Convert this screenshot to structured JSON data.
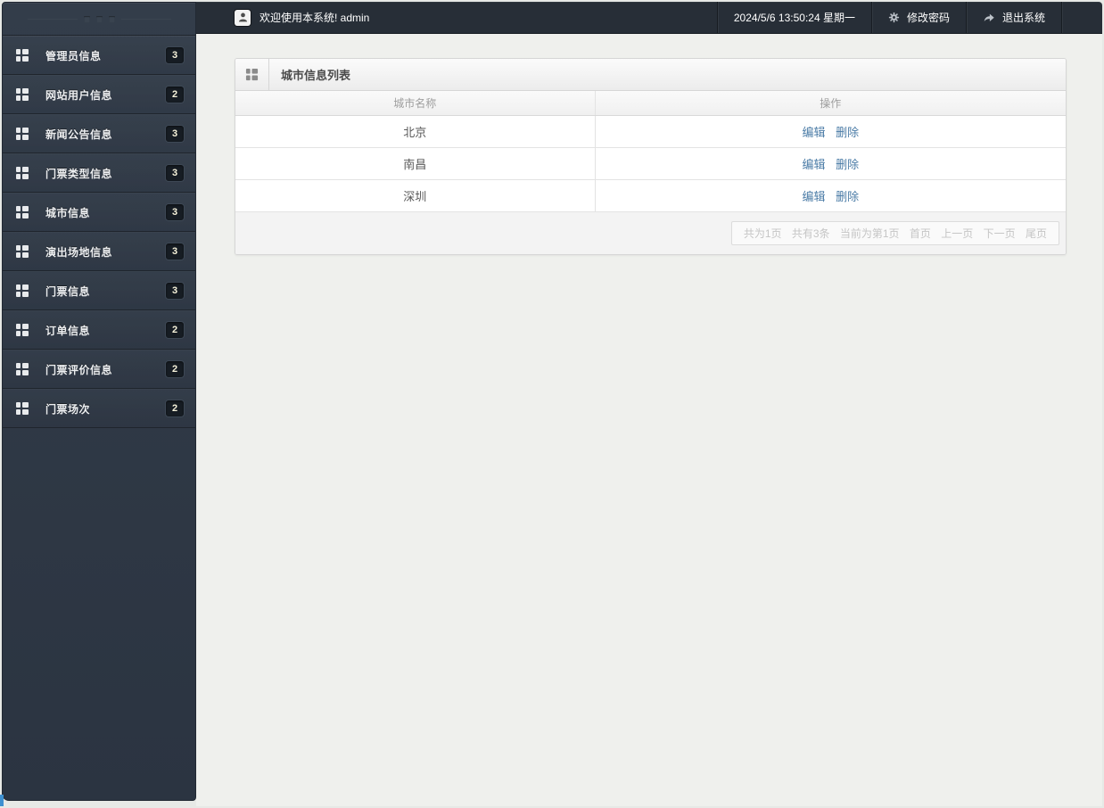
{
  "sidebar": {
    "items": [
      {
        "label": "管理员信息",
        "badge": "3"
      },
      {
        "label": "网站用户信息",
        "badge": "2"
      },
      {
        "label": "新闻公告信息",
        "badge": "3"
      },
      {
        "label": "门票类型信息",
        "badge": "3"
      },
      {
        "label": "城市信息",
        "badge": "3"
      },
      {
        "label": "演出场地信息",
        "badge": "3"
      },
      {
        "label": "门票信息",
        "badge": "3"
      },
      {
        "label": "订单信息",
        "badge": "2"
      },
      {
        "label": "门票评价信息",
        "badge": "2"
      },
      {
        "label": "门票场次",
        "badge": "2"
      }
    ]
  },
  "header": {
    "welcome": "欢迎使用本系统! admin",
    "datetime": "2024/5/6 13:50:24 星期一",
    "change_password": "修改密码",
    "logout": "退出系统"
  },
  "panel": {
    "title": "城市信息列表",
    "table": {
      "col_city": "城市名称",
      "col_actions": "操作",
      "edit_label": "编辑",
      "delete_label": "删除",
      "rows": [
        {
          "city": "北京"
        },
        {
          "city": "南昌"
        },
        {
          "city": "深圳"
        }
      ]
    },
    "pagination": {
      "pages_info": "共为1页",
      "count_info": "共有3条",
      "current_info": "当前为第1页",
      "first": "首页",
      "prev": "上一页",
      "next": "下一页",
      "last": "尾页"
    }
  },
  "colors": {
    "sidebar_bg": "#2e3844",
    "topbar_bg": "#272e37",
    "main_bg": "#eff0ed",
    "link": "#4a7ba6",
    "badge_text": "#f6f2da",
    "pagination_text": "#c5c5c5"
  }
}
